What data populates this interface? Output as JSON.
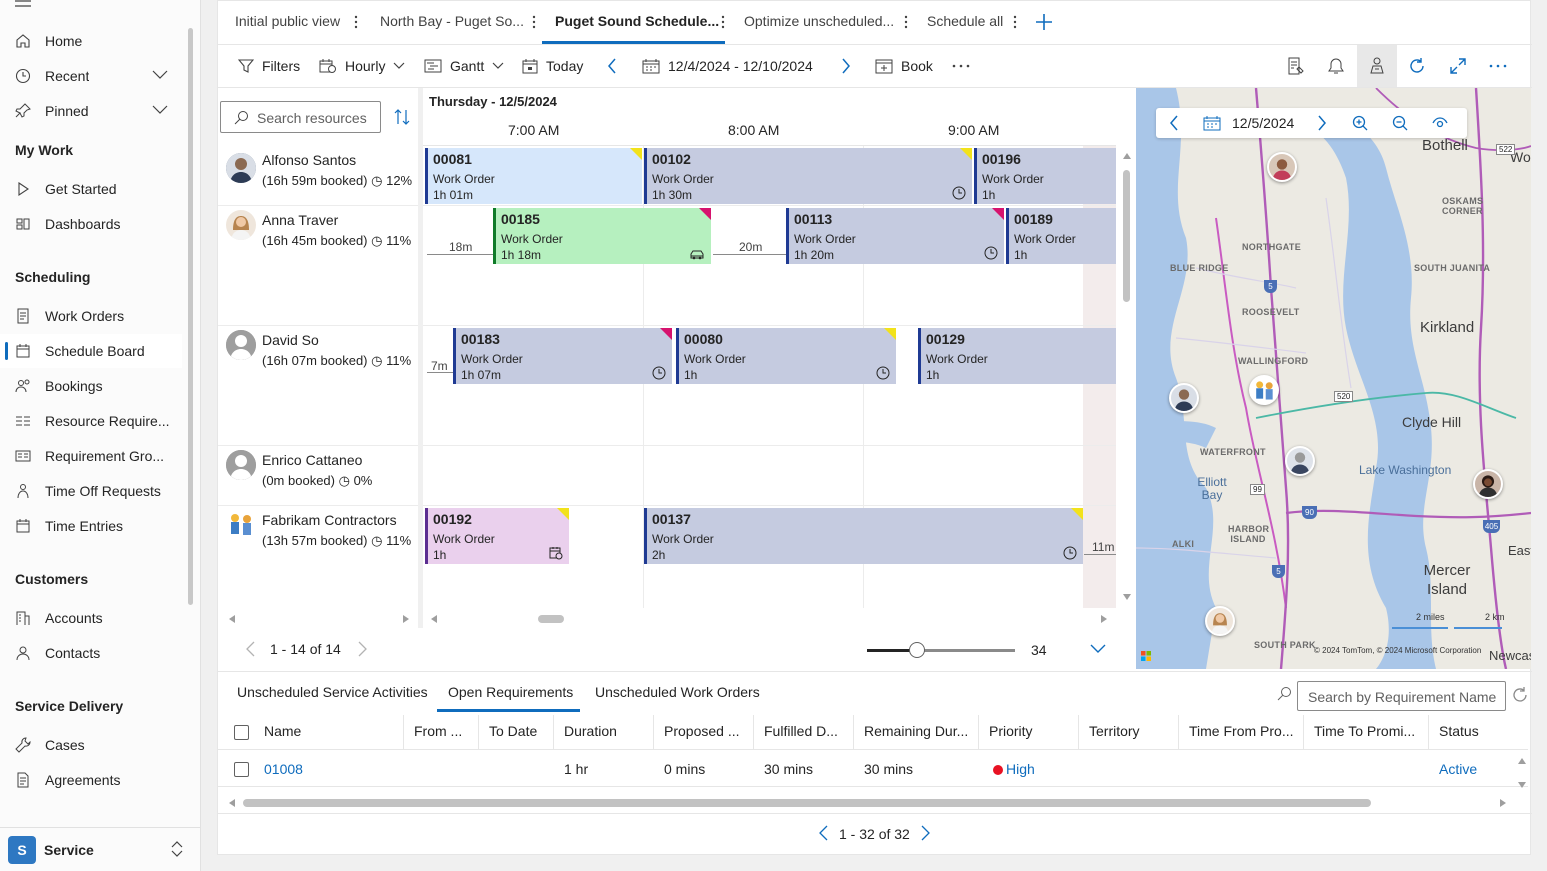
{
  "sidebar": {
    "items": [
      {
        "label": "Home"
      },
      {
        "label": "Recent"
      },
      {
        "label": "Pinned"
      }
    ],
    "sections": [
      {
        "title": "My Work",
        "items": [
          {
            "label": "Get Started"
          },
          {
            "label": "Dashboards"
          }
        ]
      },
      {
        "title": "Scheduling",
        "items": [
          {
            "label": "Work Orders"
          },
          {
            "label": "Schedule Board"
          },
          {
            "label": "Bookings"
          },
          {
            "label": "Resource Require..."
          },
          {
            "label": "Requirement Gro..."
          },
          {
            "label": "Time Off Requests"
          },
          {
            "label": "Time Entries"
          }
        ]
      },
      {
        "title": "Customers",
        "items": [
          {
            "label": "Accounts"
          },
          {
            "label": "Contacts"
          }
        ]
      },
      {
        "title": "Service Delivery",
        "items": [
          {
            "label": "Cases"
          },
          {
            "label": "Agreements"
          }
        ]
      }
    ],
    "area": {
      "badge": "S",
      "label": "Service"
    }
  },
  "tabs": [
    {
      "label": "Initial public view"
    },
    {
      "label": "North Bay - Puget So..."
    },
    {
      "label": "Puget Sound Schedule..."
    },
    {
      "label": "Optimize unscheduled..."
    },
    {
      "label": "Schedule all"
    }
  ],
  "toolbar": {
    "filters": "Filters",
    "hourly": "Hourly",
    "gantt": "Gantt",
    "today": "Today",
    "date_range": "12/4/2024 - 12/10/2024",
    "book": "Book"
  },
  "board": {
    "search_placeholder": "Search resources",
    "day_label": "Thursday - 12/5/2024",
    "hours": [
      "7:00 AM",
      "8:00 AM",
      "9:00 AM"
    ],
    "resources": [
      {
        "name": "Alfonso Santos",
        "booked": "(16h 59m booked)",
        "pct": "12%"
      },
      {
        "name": "Anna Traver",
        "booked": "(16h 45m booked)",
        "pct": "11%"
      },
      {
        "name": "David So",
        "booked": "(16h 07m booked)",
        "pct": "11%"
      },
      {
        "name": "Enrico Cattaneo",
        "booked": "(0m booked)",
        "pct": "0%"
      },
      {
        "name": "Fabrikam Contractors",
        "booked": "(13h 57m booked)",
        "pct": "11%"
      }
    ],
    "bookings": [
      {
        "id": "00081",
        "type": "Work Order",
        "dur": "1h 01m"
      },
      {
        "id": "00102",
        "type": "Work Order",
        "dur": "1h 30m"
      },
      {
        "id": "00196",
        "type": "Work Order",
        "dur": "1h"
      },
      {
        "id": "00185",
        "type": "Work Order",
        "dur": "1h 18m"
      },
      {
        "id": "00113",
        "type": "Work Order",
        "dur": "1h 20m"
      },
      {
        "id": "00189",
        "type": "Work Order",
        "dur": "1h"
      },
      {
        "id": "00183",
        "type": "Work Order",
        "dur": "1h 07m"
      },
      {
        "id": "00080",
        "type": "Work Order",
        "dur": "1h"
      },
      {
        "id": "00129",
        "type": "Work Order",
        "dur": "1h"
      },
      {
        "id": "00192",
        "type": "Work Order",
        "dur": "1h"
      },
      {
        "id": "00137",
        "type": "Work Order",
        "dur": "2h"
      }
    ],
    "gaps": [
      "18m",
      "20m",
      "7m",
      "11m"
    ],
    "pager": "1 - 14 of 14",
    "zoom": "34"
  },
  "map": {
    "date": "12/5/2024",
    "cities": [
      "Bothell",
      "Kirkland",
      "Clyde Hill",
      "Mercer Island"
    ],
    "neighborhoods": [
      "NORTHGATE",
      "BLUE RIDGE",
      "ROOSEVELT",
      "WALLINGFORD",
      "WATERFRONT",
      "HARBOR ISLAND",
      "ALKI",
      "SOUTH PARK",
      "OSKAMS CORNER",
      "SOUTH JUANITA"
    ],
    "waters": [
      "Lake Washington",
      "Elliott Bay"
    ],
    "partial_labels": [
      "Wo",
      "East",
      "Newcastle"
    ],
    "roads": [
      "522",
      "5",
      "520",
      "99",
      "90",
      "405",
      "5"
    ],
    "scale": [
      "2 miles",
      "2 km"
    ],
    "copyright": "© 2024 TomTom, © 2024 Microsoft Corporation"
  },
  "bottom": {
    "tabs": [
      "Unscheduled Service Activities",
      "Open Requirements",
      "Unscheduled Work Orders"
    ],
    "search_placeholder": "Search by Requirement Name",
    "columns": [
      "Name",
      "From ...",
      "To Date",
      "Duration",
      "Proposed ...",
      "Fulfilled D...",
      "Remaining Dur...",
      "Priority",
      "Territory",
      "Time From Pro...",
      "Time To Promi...",
      "Status"
    ],
    "rows": [
      {
        "name": "01008",
        "duration": "1 hr",
        "proposed": "0 mins",
        "fulfilled": "30 mins",
        "remaining": "30 mins",
        "priority": "High",
        "status": "Active"
      }
    ],
    "pager": "1 - 32 of 32"
  },
  "colors": {
    "accent": "#0f6cbd",
    "booking_gray": "#c5cbe0",
    "booking_blue": "#d6e7fb",
    "booking_green": "#b6f0bf",
    "booking_purple": "#ead0ed",
    "high": "#e81123"
  }
}
